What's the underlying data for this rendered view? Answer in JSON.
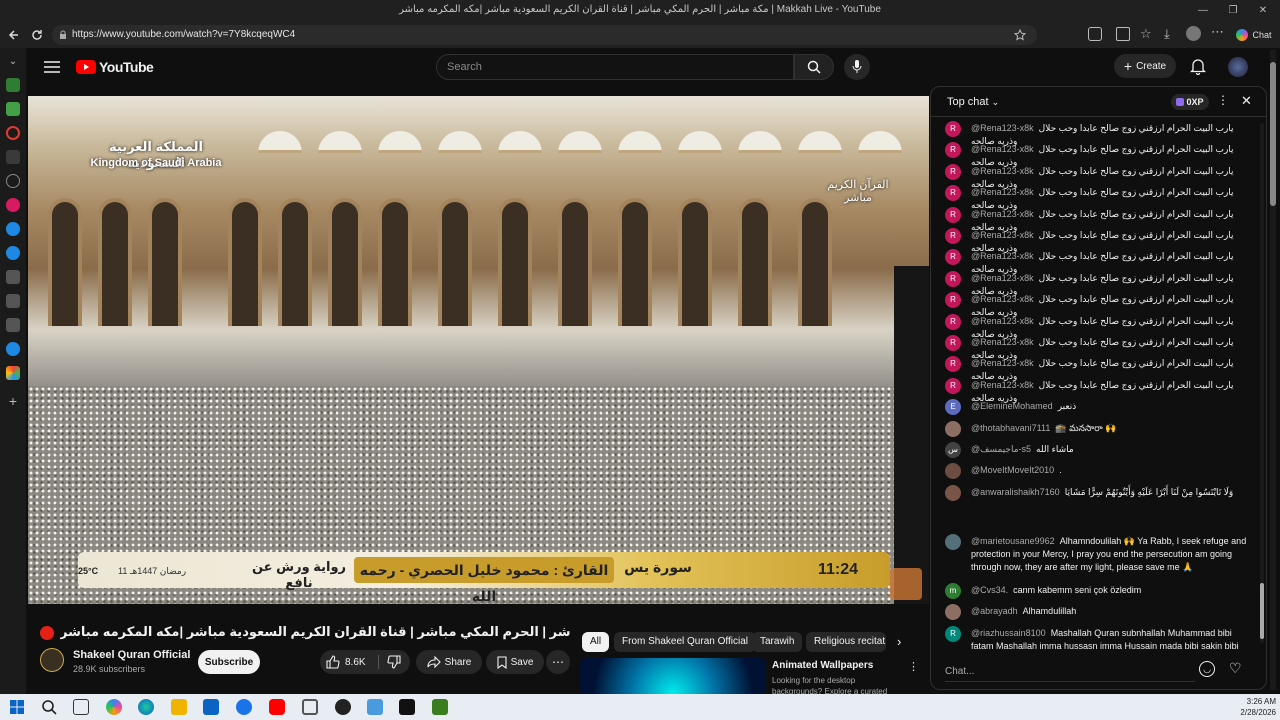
{
  "window": {
    "title": "مكة مباشر | الحرم المكي مباشر | قناة القران الكريم السعودية مباشر |مكه المكرمه مباشر | Makkah Live - YouTube"
  },
  "browser": {
    "url": "https://www.youtube.com/watch?v=7Y8kcqeqWC4",
    "chat_label": "Chat"
  },
  "youtube": {
    "logo": "YouTube",
    "search_placeholder": "Search",
    "create_label": "Create"
  },
  "video": {
    "overlay_country_ar": "المملكة العربية السعودية",
    "overlay_country_en": "Kingdom of Saudi Arabia",
    "overlay_channel_ar": "القرآن الكريم مباشر",
    "temperature": "25°C",
    "hijri_date": "11 رمضان 1447هـ",
    "riwaya": "رواية ورش عن نافع",
    "qari": "القارئ : محمود خليل الحصري - رحمه الله",
    "surah": "سورة يس",
    "time": "11:24"
  },
  "meta": {
    "title": "مكة مباشر | الحرم المكي مباشر | قناة القران الكريم السعودية مباشر |مكه المكرمه مباشر | Makkah Live",
    "channel": "Shakeel Quran Official",
    "subscribers": "28.9K subscribers",
    "subscribe_label": "Subscribe",
    "likes": "8.6K",
    "share_label": "Share",
    "save_label": "Save"
  },
  "chips": [
    "All",
    "From Shakeel Quran Official",
    "Tarawih",
    "Religious recitat"
  ],
  "recommendation": {
    "title": "Animated Wallpapers",
    "description": "Looking for the desktop backgrounds? Explore a curated"
  },
  "chat": {
    "header": "Top chat",
    "xp": "0XP",
    "input_placeholder": "Chat...",
    "messages": [
      {
        "initial": "R",
        "color": "#c2185b",
        "author": "@Rena123-x8k",
        "text": "يارب البيت الحرام ارزقني زوج صالح عابدا وحب حلال وذريه صالحه"
      },
      {
        "initial": "R",
        "color": "#c2185b",
        "author": "@Rena123-x8k",
        "text": "يارب البيت الحرام ارزقني زوج صالح عابدا وحب حلال وذريه صالحه"
      },
      {
        "initial": "R",
        "color": "#c2185b",
        "author": "@Rena123-x8k",
        "text": "يارب البيت الحرام ارزقني زوج صالح عابدا وحب حلال وذريه صالحه"
      },
      {
        "initial": "R",
        "color": "#c2185b",
        "author": "@Rena123-x8k",
        "text": "يارب البيت الحرام ارزقني زوج صالح عابدا وحب حلال وذريه صالحه"
      },
      {
        "initial": "R",
        "color": "#c2185b",
        "author": "@Rena123-x8k",
        "text": "يارب البيت الحرام ارزقني زوج صالح عابدا وحب حلال وذريه صالحه"
      },
      {
        "initial": "R",
        "color": "#c2185b",
        "author": "@Rena123-x8k",
        "text": "يارب البيت الحرام ارزقني زوج صالح عابدا وحب حلال وذريه صالحه"
      },
      {
        "initial": "R",
        "color": "#c2185b",
        "author": "@Rena123-x8k",
        "text": "يارب البيت الحرام ارزقني زوج صالح عابدا وحب حلال وذريه صالحه"
      },
      {
        "initial": "R",
        "color": "#c2185b",
        "author": "@Rena123-x8k",
        "text": "يارب البيت الحرام ارزقني زوج صالح عابدا وحب حلال وذريه صالحه"
      },
      {
        "initial": "R",
        "color": "#c2185b",
        "author": "@Rena123-x8k",
        "text": "يارب البيت الحرام ارزقني زوج صالح عابدا وحب حلال وذريه صالحه"
      },
      {
        "initial": "R",
        "color": "#c2185b",
        "author": "@Rena123-x8k",
        "text": "يارب البيت الحرام ارزقني زوج صالح عابدا وحب حلال وذريه صالحه"
      },
      {
        "initial": "R",
        "color": "#c2185b",
        "author": "@Rena123-x8k",
        "text": "يارب البيت الحرام ارزقني زوج صالح عابدا وحب حلال وذريه صالحه"
      },
      {
        "initial": "R",
        "color": "#c2185b",
        "author": "@Rena123-x8k",
        "text": "يارب البيت الحرام ارزقني زوج صالح عابدا وحب حلال وذريه صالحه"
      },
      {
        "initial": "R",
        "color": "#c2185b",
        "author": "@Rena123-x8k",
        "text": "يارب البيت الحرام ارزقني زوج صالح عابدا وحب حلال وذريه صالحه"
      },
      {
        "initial": "E",
        "color": "#5c6bc0",
        "author": "@EleminеMohamed",
        "text": "ذنعبر"
      },
      {
        "initial": "",
        "color": "#8d6e63",
        "author": "@thotabhavani7111",
        "text": "🕋 మనసారా 🙌"
      },
      {
        "initial": "س",
        "color": "#424242",
        "author": "@ماجيمسف-s5",
        "text": "ماشاء الله"
      },
      {
        "initial": "",
        "color": "#6d4c41",
        "author": "@MoveItMoveIt2010",
        "text": "."
      },
      {
        "initial": "",
        "color": "#795548",
        "author": "@anwaralishaikh7160",
        "text": "وَلَا تَايْتَسُوا مِنْ لَنَا أَبْرًا عَلَيْهِ وَأَيْتُوتَهُمْ سِرًّا مَشَايَا"
      },
      {
        "initial": "",
        "color": "#546e7a",
        "author": "@marietousane9962",
        "text": "Alhamndoulilah 🙌 Ya Rabb, I seek refuge and protection in your Mercy, I pray you end the persecution am going through now, they are after my light, please save me 🙏"
      },
      {
        "initial": "m",
        "color": "#2e7d32",
        "author": "@Cvs34.",
        "text": "canm kabemm seni çok özledim"
      },
      {
        "initial": "",
        "color": "#8d6e63",
        "author": "@abrayadh",
        "text": "Alhamdulillah"
      },
      {
        "initial": "R",
        "color": "#00897b",
        "author": "@riazhussain8100",
        "text": "Mashallah Quran subnhallah Muhammad bibi fatam Mashallah imma hussasn imma Hussain mada bibi sakin bibi Amina imma hussasn imma Hussain mada imma Mhadi imma Ali Gazi Abssa Mashallah Qurna"
      },
      {
        "initial": "k",
        "color": "#7b1fa2",
        "author": "@kubi-m1w",
        "text": "ELHAMDÜLİLLAH"
      }
    ]
  },
  "taskbar": {
    "time": "3:26 AM",
    "date": "2/28/2026"
  },
  "colors": {
    "youtube_red": "#ff0000",
    "live_red": "#e62117",
    "background": "#0f0f0f"
  }
}
